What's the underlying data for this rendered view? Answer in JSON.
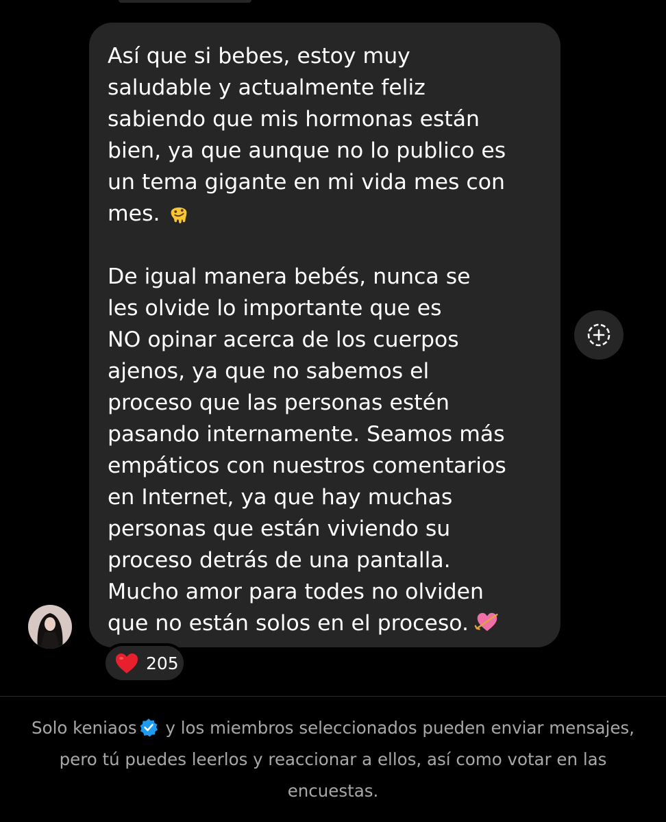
{
  "message": {
    "paragraph_1": "Así que si bebes, estoy muy\nsaludable y actualmente feliz\nsabiendo que mis hormonas están\nbien, ya que aunque no lo publico es\nun tema gigante en mi vida mes con\nmes.",
    "paragraph_1_emoji": "melting-face-emoji",
    "paragraph_2": "De igual manera bebés, nunca se\nles olvide lo importante que es\nNO opinar acerca de los cuerpos\najenos, ya que no sabemos el\nproceso que las personas estén\npasando internamente. Seamos más\nempáticos con nuestros comentarios\nen Internet, ya que hay muchas\npersonas que están viviendo su\nproceso detrás de una pantalla.\nMucho amor para todes no olviden\nque no están solos en el proceso.",
    "paragraph_2_emoji": "heart-with-arrow-emoji",
    "bubble_color": "#262626",
    "text_color": "#ffffff"
  },
  "reaction": {
    "icon": "red-heart-icon",
    "count": "205",
    "color": "#e8202e"
  },
  "add_reaction_icon": "add-reaction-icon",
  "sender": {
    "avatar": "avatar-photo"
  },
  "footer": {
    "prefix": "Solo keniaos",
    "verified_icon": "verified-badge-icon",
    "suffix": " y los miembros seleccionados pueden enviar mensajes, pero tú puedes leerlos y reaccionar a ellos, así como votar en las encuestas.",
    "text_color": "#a8a8a8",
    "badge_color": "#1d9bf0"
  }
}
